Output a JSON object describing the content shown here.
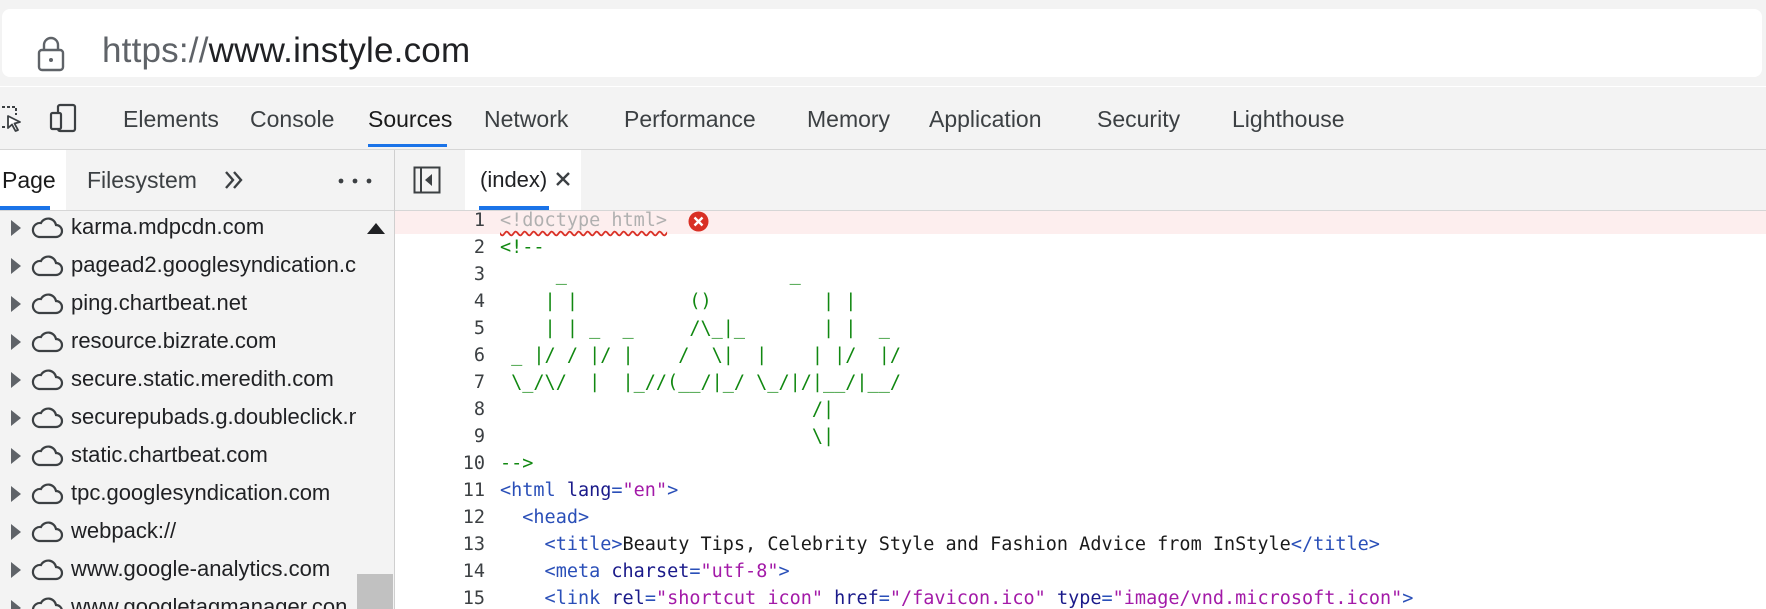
{
  "address_bar": {
    "scheme": "https://",
    "host": "www.instyle.com"
  },
  "devtools_tabs": [
    {
      "label": "Elements"
    },
    {
      "label": "Console"
    },
    {
      "label": "Sources",
      "active": true
    },
    {
      "label": "Network"
    },
    {
      "label": "Performance"
    },
    {
      "label": "Memory"
    },
    {
      "label": "Application"
    },
    {
      "label": "Security"
    },
    {
      "label": "Lighthouse"
    }
  ],
  "navigator": {
    "tabs": [
      {
        "label": "Page",
        "active": true
      },
      {
        "label": "Filesystem"
      }
    ],
    "items": [
      "karma.mdpcdn.com",
      "pagead2.googlesyndication.c",
      "ping.chartbeat.net",
      "resource.bizrate.com",
      "secure.static.meredith.com",
      "securepubads.g.doubleclick.n",
      "static.chartbeat.com",
      "tpc.googlesyndication.com",
      "webpack://",
      "www.google-analytics.com",
      "www.googletagmanager.con"
    ]
  },
  "editor": {
    "file_tab": "(index)",
    "lines": [
      {
        "n": "1",
        "parts": [
          {
            "t": "<!doctype html>",
            "c": "c-dim"
          }
        ],
        "error": true
      },
      {
        "n": "2",
        "parts": [
          {
            "t": "<!--",
            "c": "c-comment"
          }
        ]
      },
      {
        "n": "3",
        "parts": [
          {
            "t": "     _                    _",
            "c": "c-comment"
          }
        ]
      },
      {
        "n": "4",
        "parts": [
          {
            "t": "    | |          ()          | |",
            "c": "c-comment"
          }
        ]
      },
      {
        "n": "5",
        "parts": [
          {
            "t": "    | | _  _     /\\_|_       | |  _",
            "c": "c-comment"
          }
        ]
      },
      {
        "n": "6",
        "parts": [
          {
            "t": " _ |/ / |/ |    /  \\|  |    | |/  |/",
            "c": "c-comment"
          }
        ]
      },
      {
        "n": "7",
        "parts": [
          {
            "t": " \\_/\\/  |  |_//(__/|_/ \\_/|/|__/|__/",
            "c": "c-comment"
          }
        ]
      },
      {
        "n": "8",
        "parts": [
          {
            "t": "                            /|",
            "c": "c-comment"
          }
        ]
      },
      {
        "n": "9",
        "parts": [
          {
            "t": "                            \\|",
            "c": "c-comment"
          }
        ]
      },
      {
        "n": "10",
        "parts": [
          {
            "t": "-->",
            "c": "c-comment"
          }
        ]
      },
      {
        "n": "11",
        "parts": [
          {
            "t": "<html ",
            "c": "c-tag"
          },
          {
            "t": "lang",
            "c": "c-attr"
          },
          {
            "t": "=",
            "c": "c-tag"
          },
          {
            "t": "\"en\"",
            "c": "c-val"
          },
          {
            "t": ">",
            "c": "c-tag"
          }
        ]
      },
      {
        "n": "12",
        "parts": [
          {
            "t": "  <head>",
            "c": "c-tag"
          }
        ]
      },
      {
        "n": "13",
        "parts": [
          {
            "t": "    <title>",
            "c": "c-tag"
          },
          {
            "t": "Beauty Tips, Celebrity Style and Fashion Advice from InStyle",
            "c": "c-text"
          },
          {
            "t": "</title>",
            "c": "c-tag"
          }
        ]
      },
      {
        "n": "14",
        "parts": [
          {
            "t": "    <meta ",
            "c": "c-tag"
          },
          {
            "t": "charset",
            "c": "c-attr"
          },
          {
            "t": "=",
            "c": "c-tag"
          },
          {
            "t": "\"utf-8\"",
            "c": "c-val"
          },
          {
            "t": ">",
            "c": "c-tag"
          }
        ]
      },
      {
        "n": "15",
        "parts": [
          {
            "t": "    <link ",
            "c": "c-tag"
          },
          {
            "t": "rel",
            "c": "c-attr"
          },
          {
            "t": "=",
            "c": "c-tag"
          },
          {
            "t": "\"shortcut icon\"",
            "c": "c-val"
          },
          {
            "t": " href",
            "c": "c-attr"
          },
          {
            "t": "=",
            "c": "c-tag"
          },
          {
            "t": "\"/favicon.ico\"",
            "c": "c-val"
          },
          {
            "t": " type",
            "c": "c-attr"
          },
          {
            "t": "=",
            "c": "c-tag"
          },
          {
            "t": "\"image/vnd.microsoft.icon\"",
            "c": "c-val"
          },
          {
            "t": ">",
            "c": "c-tag"
          }
        ]
      }
    ]
  },
  "colors": {
    "accent": "#1a73e8",
    "error": "#d93025",
    "comment": "#118811",
    "tag": "#2a4fb8",
    "value": "#a31aa8"
  },
  "icons": [
    "lock-icon",
    "inspect-icon",
    "device-toolbar-icon",
    "chevron-right-icon",
    "more-icon",
    "cloud-icon",
    "sidebar-toggle-icon",
    "close-icon",
    "error-icon",
    "scroll-up-icon"
  ]
}
